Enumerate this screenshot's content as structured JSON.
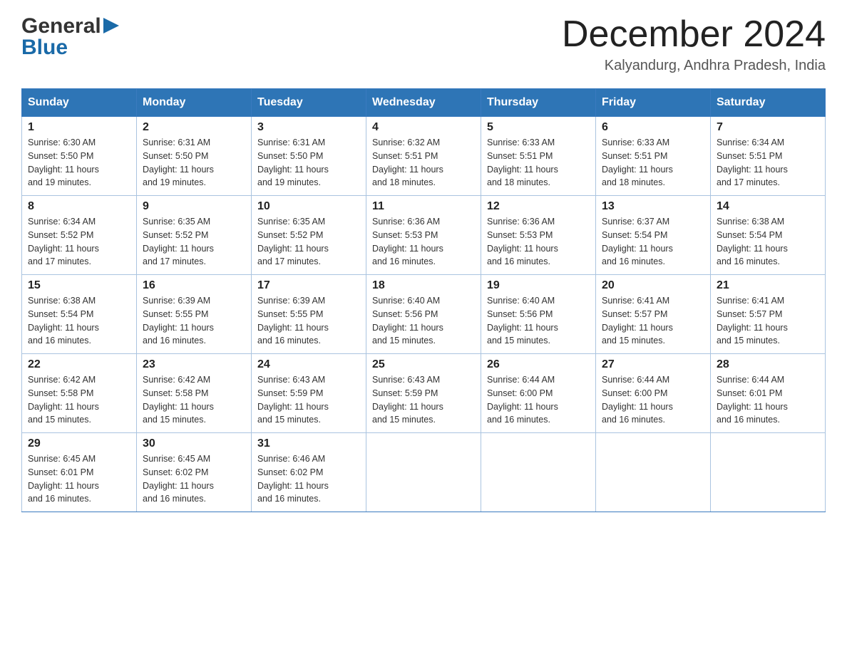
{
  "header": {
    "logo_general": "General",
    "logo_blue": "Blue",
    "month_title": "December 2024",
    "location": "Kalyandurg, Andhra Pradesh, India"
  },
  "days_of_week": [
    "Sunday",
    "Monday",
    "Tuesday",
    "Wednesday",
    "Thursday",
    "Friday",
    "Saturday"
  ],
  "weeks": [
    [
      {
        "day": "1",
        "sunrise": "6:30 AM",
        "sunset": "5:50 PM",
        "daylight": "11 hours and 19 minutes."
      },
      {
        "day": "2",
        "sunrise": "6:31 AM",
        "sunset": "5:50 PM",
        "daylight": "11 hours and 19 minutes."
      },
      {
        "day": "3",
        "sunrise": "6:31 AM",
        "sunset": "5:50 PM",
        "daylight": "11 hours and 19 minutes."
      },
      {
        "day": "4",
        "sunrise": "6:32 AM",
        "sunset": "5:51 PM",
        "daylight": "11 hours and 18 minutes."
      },
      {
        "day": "5",
        "sunrise": "6:33 AM",
        "sunset": "5:51 PM",
        "daylight": "11 hours and 18 minutes."
      },
      {
        "day": "6",
        "sunrise": "6:33 AM",
        "sunset": "5:51 PM",
        "daylight": "11 hours and 18 minutes."
      },
      {
        "day": "7",
        "sunrise": "6:34 AM",
        "sunset": "5:51 PM",
        "daylight": "11 hours and 17 minutes."
      }
    ],
    [
      {
        "day": "8",
        "sunrise": "6:34 AM",
        "sunset": "5:52 PM",
        "daylight": "11 hours and 17 minutes."
      },
      {
        "day": "9",
        "sunrise": "6:35 AM",
        "sunset": "5:52 PM",
        "daylight": "11 hours and 17 minutes."
      },
      {
        "day": "10",
        "sunrise": "6:35 AM",
        "sunset": "5:52 PM",
        "daylight": "11 hours and 17 minutes."
      },
      {
        "day": "11",
        "sunrise": "6:36 AM",
        "sunset": "5:53 PM",
        "daylight": "11 hours and 16 minutes."
      },
      {
        "day": "12",
        "sunrise": "6:36 AM",
        "sunset": "5:53 PM",
        "daylight": "11 hours and 16 minutes."
      },
      {
        "day": "13",
        "sunrise": "6:37 AM",
        "sunset": "5:54 PM",
        "daylight": "11 hours and 16 minutes."
      },
      {
        "day": "14",
        "sunrise": "6:38 AM",
        "sunset": "5:54 PM",
        "daylight": "11 hours and 16 minutes."
      }
    ],
    [
      {
        "day": "15",
        "sunrise": "6:38 AM",
        "sunset": "5:54 PM",
        "daylight": "11 hours and 16 minutes."
      },
      {
        "day": "16",
        "sunrise": "6:39 AM",
        "sunset": "5:55 PM",
        "daylight": "11 hours and 16 minutes."
      },
      {
        "day": "17",
        "sunrise": "6:39 AM",
        "sunset": "5:55 PM",
        "daylight": "11 hours and 16 minutes."
      },
      {
        "day": "18",
        "sunrise": "6:40 AM",
        "sunset": "5:56 PM",
        "daylight": "11 hours and 15 minutes."
      },
      {
        "day": "19",
        "sunrise": "6:40 AM",
        "sunset": "5:56 PM",
        "daylight": "11 hours and 15 minutes."
      },
      {
        "day": "20",
        "sunrise": "6:41 AM",
        "sunset": "5:57 PM",
        "daylight": "11 hours and 15 minutes."
      },
      {
        "day": "21",
        "sunrise": "6:41 AM",
        "sunset": "5:57 PM",
        "daylight": "11 hours and 15 minutes."
      }
    ],
    [
      {
        "day": "22",
        "sunrise": "6:42 AM",
        "sunset": "5:58 PM",
        "daylight": "11 hours and 15 minutes."
      },
      {
        "day": "23",
        "sunrise": "6:42 AM",
        "sunset": "5:58 PM",
        "daylight": "11 hours and 15 minutes."
      },
      {
        "day": "24",
        "sunrise": "6:43 AM",
        "sunset": "5:59 PM",
        "daylight": "11 hours and 15 minutes."
      },
      {
        "day": "25",
        "sunrise": "6:43 AM",
        "sunset": "5:59 PM",
        "daylight": "11 hours and 15 minutes."
      },
      {
        "day": "26",
        "sunrise": "6:44 AM",
        "sunset": "6:00 PM",
        "daylight": "11 hours and 16 minutes."
      },
      {
        "day": "27",
        "sunrise": "6:44 AM",
        "sunset": "6:00 PM",
        "daylight": "11 hours and 16 minutes."
      },
      {
        "day": "28",
        "sunrise": "6:44 AM",
        "sunset": "6:01 PM",
        "daylight": "11 hours and 16 minutes."
      }
    ],
    [
      {
        "day": "29",
        "sunrise": "6:45 AM",
        "sunset": "6:01 PM",
        "daylight": "11 hours and 16 minutes."
      },
      {
        "day": "30",
        "sunrise": "6:45 AM",
        "sunset": "6:02 PM",
        "daylight": "11 hours and 16 minutes."
      },
      {
        "day": "31",
        "sunrise": "6:46 AM",
        "sunset": "6:02 PM",
        "daylight": "11 hours and 16 minutes."
      },
      null,
      null,
      null,
      null
    ]
  ],
  "labels": {
    "sunrise": "Sunrise:",
    "sunset": "Sunset:",
    "daylight": "Daylight:"
  }
}
